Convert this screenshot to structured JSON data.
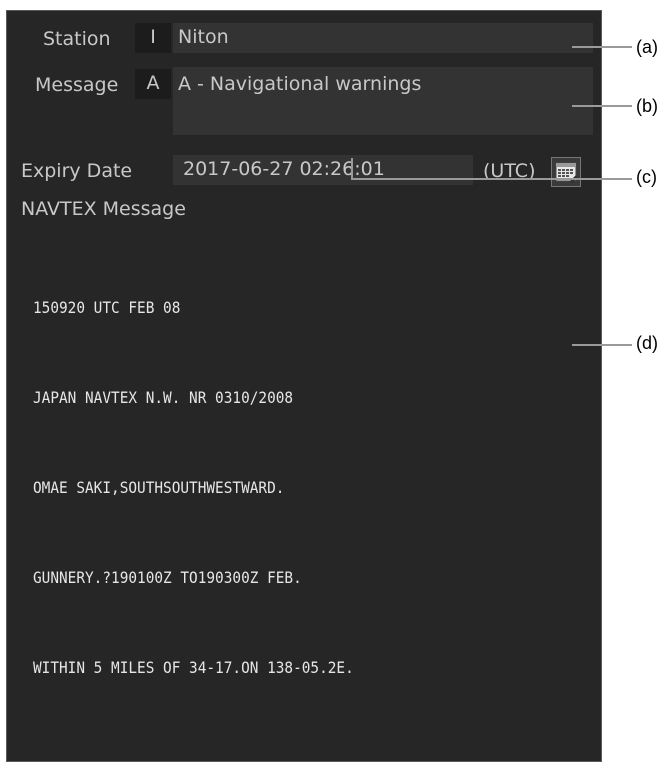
{
  "form": {
    "station_label": "Station",
    "station_code": "I",
    "station_value": "Niton",
    "message_label": "Message",
    "message_code": "A",
    "message_value": "A - Navigational warnings",
    "expiry_label": "Expiry Date",
    "expiry_value": "2017-06-27 02:26:01",
    "expiry_tz": "(UTC)",
    "calendar_icon": "calendar-icon",
    "navtex_label": "NAVTEX Message"
  },
  "navtex_message": {
    "lines": [
      "150920 UTC FEB 08",
      "JAPAN NAVTEX N.W. NR 0310/2008",
      "OMAE SAKI,SOUTHSOUTHWESTWARD.",
      "GUNNERY.?190100Z TO190300Z FEB.",
      "WITHIN 5 MILES OF 34-17.ON 138-05.2E."
    ]
  },
  "callouts": {
    "a": "(a)",
    "b": "(b)",
    "c": "(c)",
    "d": "(d)"
  },
  "colors": {
    "panel_bg": "#262626",
    "field_bg": "#333333",
    "text": "#c8c8c8"
  }
}
